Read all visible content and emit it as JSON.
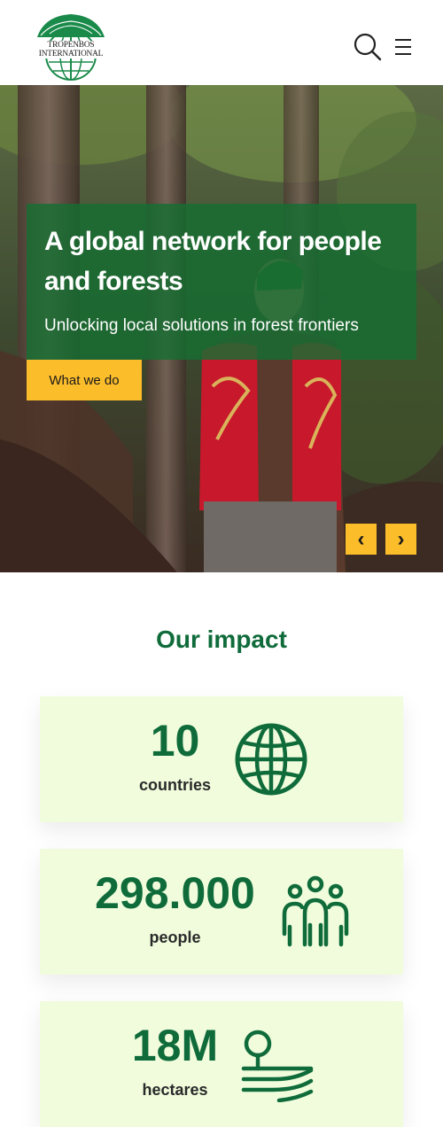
{
  "header": {
    "logo_text": "TROPENBOS INTERNATIONAL",
    "search_icon": "search-icon",
    "menu_icon": "hamburger-menu-icon"
  },
  "hero": {
    "title": "A global network for people and forests",
    "subtitle": "Unlocking local solutions in forest frontiers",
    "cta_label": "What we do",
    "prev_label": "‹",
    "next_label": "›"
  },
  "impact": {
    "title": "Our impact",
    "items": [
      {
        "value": "10",
        "label": "countries",
        "icon": "globe-icon"
      },
      {
        "value": "298.000",
        "label": "people",
        "icon": "people-icon"
      },
      {
        "value": "18M",
        "label": "hectares",
        "icon": "landscape-tree-icon"
      }
    ]
  },
  "colors": {
    "brand_green": "#0f6b3a",
    "accent_yellow": "#fcbd2b",
    "card_bg": "#f0fcdc"
  }
}
